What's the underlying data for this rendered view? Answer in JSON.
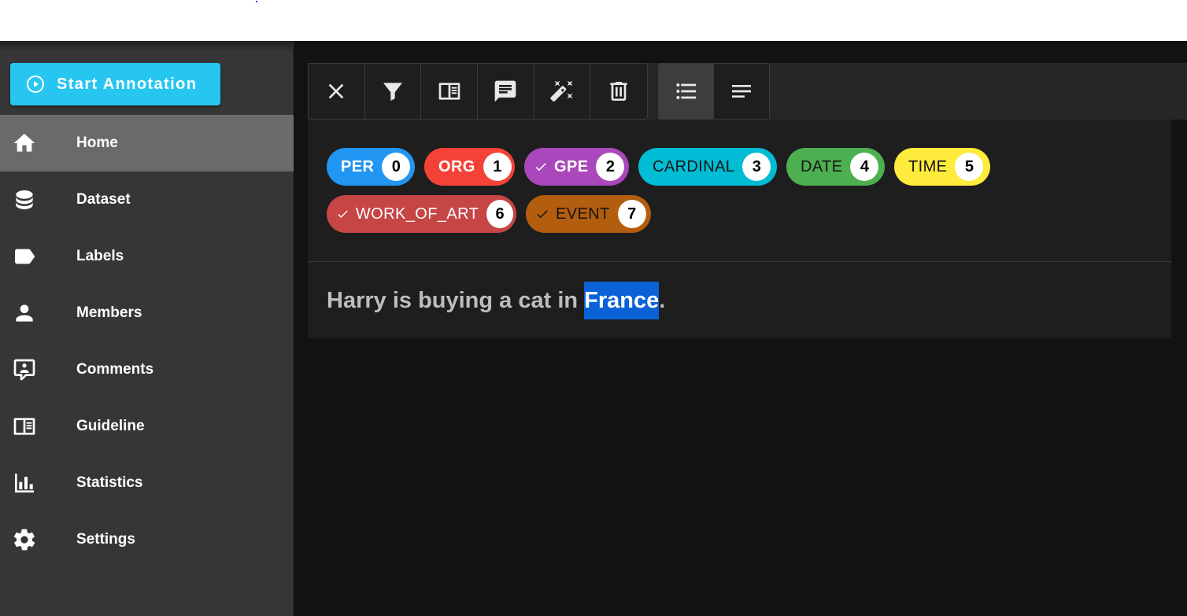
{
  "sidebar": {
    "start_button": "Start Annotation",
    "items": [
      {
        "label": "Home",
        "icon": "home-icon",
        "active": true
      },
      {
        "label": "Dataset",
        "icon": "database-icon"
      },
      {
        "label": "Labels",
        "icon": "label-icon"
      },
      {
        "label": "Members",
        "icon": "account-icon"
      },
      {
        "label": "Comments",
        "icon": "comment-account-icon"
      },
      {
        "label": "Guideline",
        "icon": "book-open-icon"
      },
      {
        "label": "Statistics",
        "icon": "chart-bar-icon"
      },
      {
        "label": "Settings",
        "icon": "cog-icon"
      }
    ]
  },
  "toolbar": {
    "buttons": [
      "close-icon",
      "filter-icon",
      "guideline-icon",
      "comment-icon",
      "auto-labeling-wand-icon",
      "delete-icon"
    ],
    "view_buttons": [
      "list-view-icon",
      "text-view-icon"
    ]
  },
  "labels": [
    {
      "name": "PER",
      "key": "0",
      "color": "#2196f3",
      "checked": false
    },
    {
      "name": "ORG",
      "key": "1",
      "color": "#f44336",
      "checked": false
    },
    {
      "name": "GPE",
      "key": "2",
      "color": "#ab47bc",
      "checked": true
    },
    {
      "name": "CARDINAL",
      "key": "3",
      "color": "#00bcd4",
      "checked": false
    },
    {
      "name": "DATE",
      "key": "4",
      "color": "#4caf50",
      "checked": false
    },
    {
      "name": "TIME",
      "key": "5",
      "color": "#ffeb3b",
      "checked": false
    },
    {
      "name": "WORK_OF_ART",
      "key": "6",
      "color": "#c64545",
      "checked": true
    },
    {
      "name": "EVENT",
      "key": "7",
      "color": "#b35d0e",
      "checked": true
    }
  ],
  "document": {
    "before": "Harry is buying a cat in ",
    "selected": "France",
    "after": "."
  },
  "colors": {
    "accent": "#26c6f0",
    "selection": "#0b62d6"
  }
}
